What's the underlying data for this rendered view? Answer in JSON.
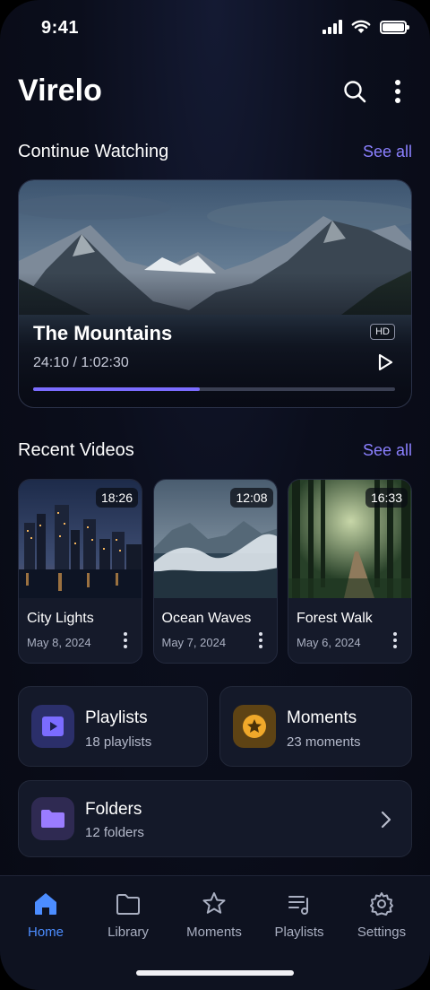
{
  "status": {
    "time": "9:41"
  },
  "header": {
    "app_title": "Virelo"
  },
  "continue": {
    "section_title": "Continue Watching",
    "see_all": "See all",
    "video": {
      "title": "The Mountains",
      "time": "24:10 / 1:02:30",
      "badge": "HD",
      "progress": 0.46
    }
  },
  "recent": {
    "section_title": "Recent Videos",
    "see_all": "See all",
    "items": [
      {
        "title": "City Lights",
        "date": "May 8, 2024",
        "duration": "18:26"
      },
      {
        "title": "Ocean Waves",
        "date": "May 7, 2024",
        "duration": "12:08"
      },
      {
        "title": "Forest Walk",
        "date": "May 6, 2024",
        "duration": "16:33"
      }
    ]
  },
  "library": {
    "playlists": {
      "name": "Playlists",
      "sub": "18 playlists"
    },
    "moments": {
      "name": "Moments",
      "sub": "23 moments"
    },
    "folders": {
      "name": "Folders",
      "sub": "12 folders"
    }
  },
  "nav": {
    "items": [
      {
        "label": "Home",
        "icon": "home-icon",
        "active": true
      },
      {
        "label": "Library",
        "icon": "folder-icon"
      },
      {
        "label": "Moments",
        "icon": "star-icon"
      },
      {
        "label": "Playlists",
        "icon": "playlist-icon"
      },
      {
        "label": "Settings",
        "icon": "gear-icon"
      }
    ]
  },
  "colors": {
    "accent": "#7b6cff",
    "link": "#8b80ff",
    "nav_active": "#4c8dff",
    "background": "#0b0e1c"
  }
}
